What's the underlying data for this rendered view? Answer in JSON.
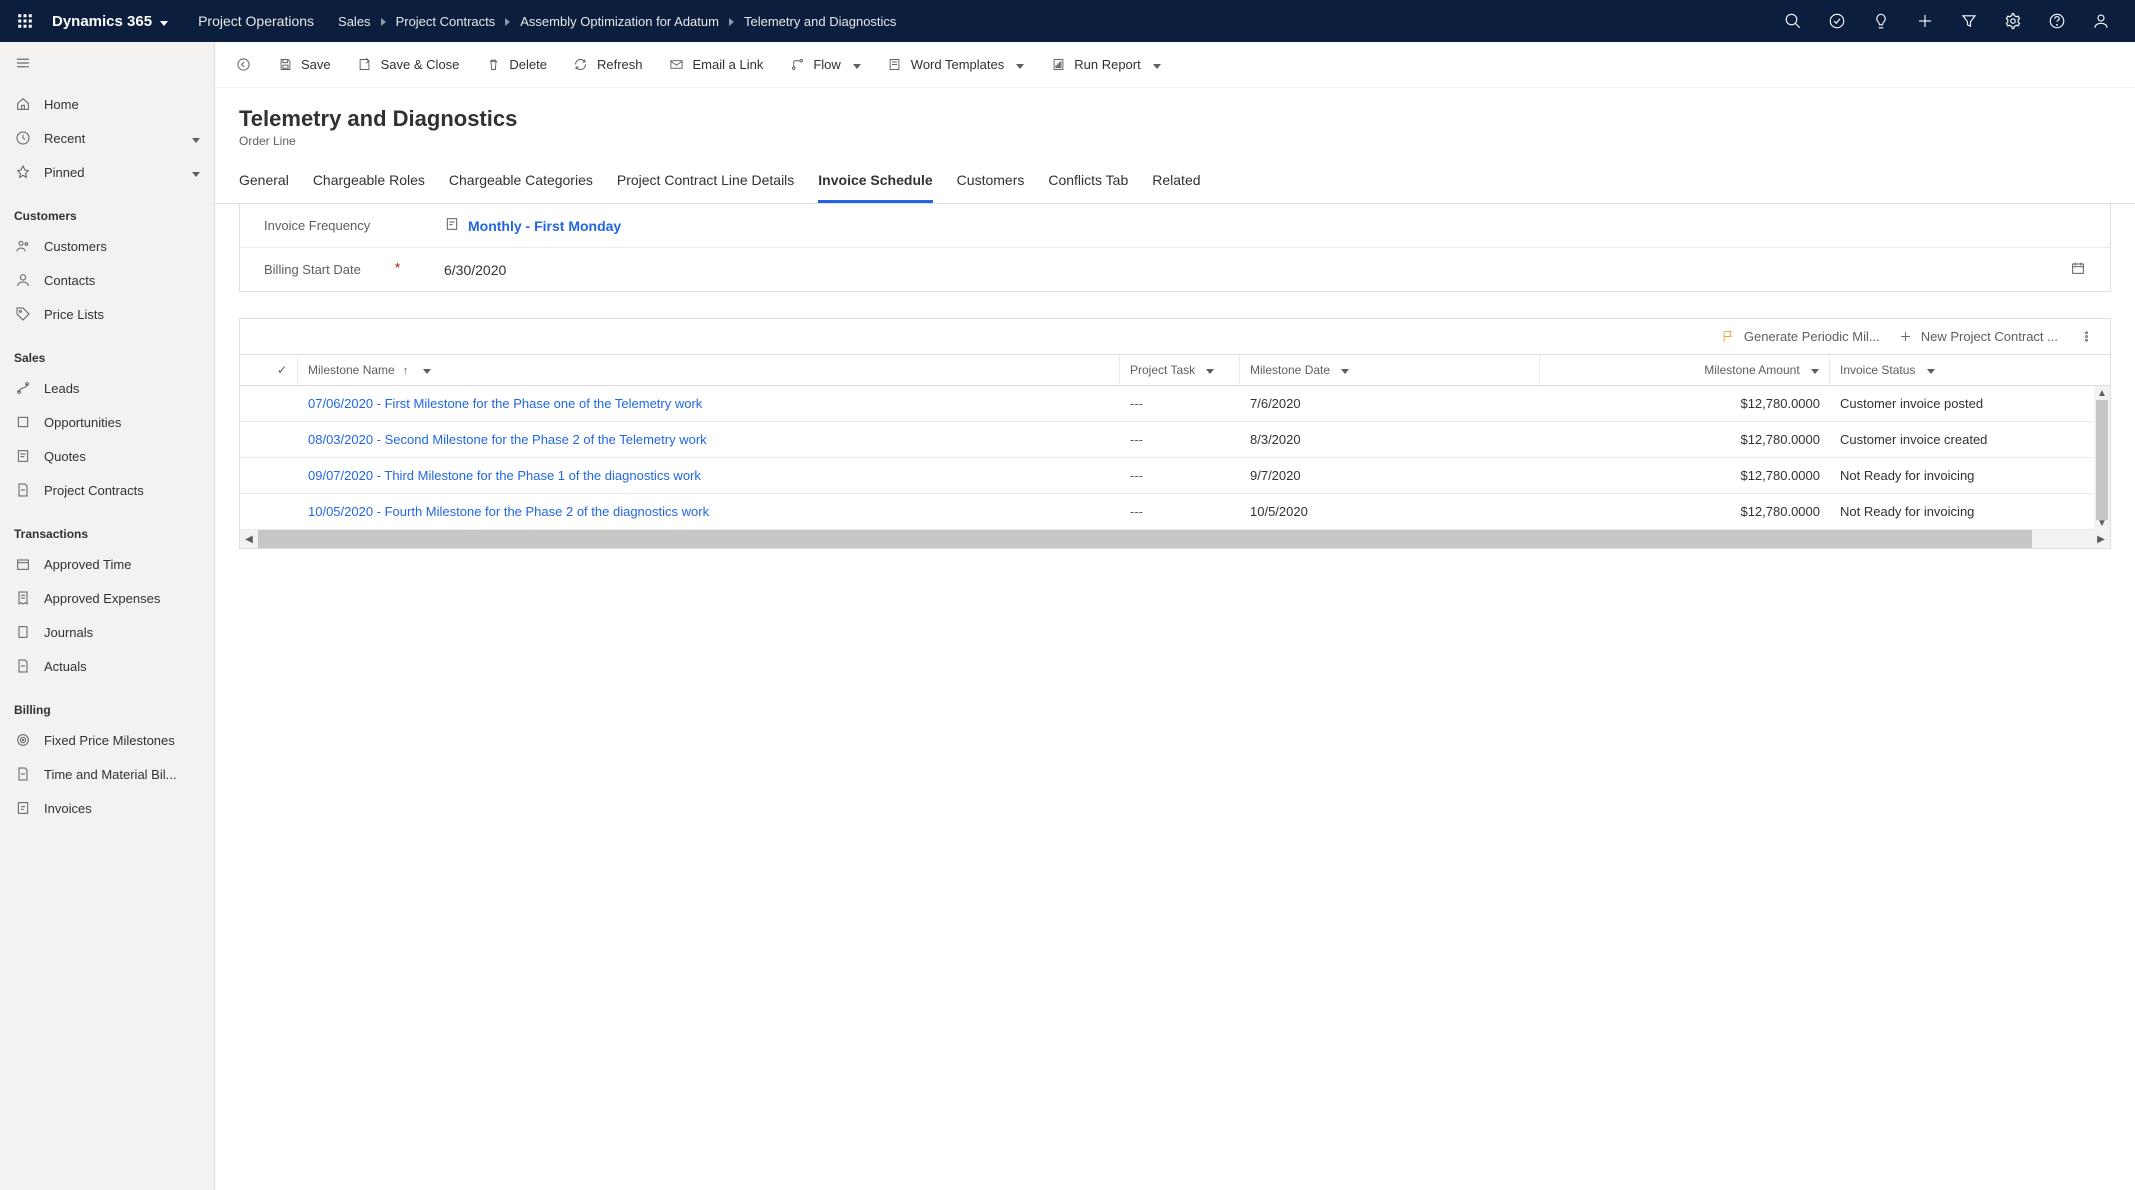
{
  "brand": "Dynamics 365",
  "module": "Project Operations",
  "breadcrumb": [
    "Sales",
    "Project Contracts",
    "Assembly Optimization for Adatum",
    "Telemetry and Diagnostics"
  ],
  "topIcons": [
    "search",
    "target",
    "bulb",
    "add",
    "filter",
    "gear",
    "help",
    "user"
  ],
  "commands": {
    "save": "Save",
    "saveClose": "Save & Close",
    "delete": "Delete",
    "refresh": "Refresh",
    "email": "Email a Link",
    "flow": "Flow",
    "word": "Word Templates",
    "report": "Run Report"
  },
  "page": {
    "title": "Telemetry and Diagnostics",
    "subtitle": "Order Line"
  },
  "tabs": [
    "General",
    "Chargeable Roles",
    "Chargeable Categories",
    "Project Contract Line Details",
    "Invoice Schedule",
    "Customers",
    "Conflicts Tab",
    "Related"
  ],
  "activeTab": 4,
  "form": {
    "invoiceFreqLabel": "Invoice Frequency",
    "invoiceFreqValue": "Monthly - First Monday",
    "billingStartLabel": "Billing Start Date",
    "billingStartValue": "6/30/2020"
  },
  "gridToolbar": {
    "generate": "Generate Periodic Mil...",
    "new": "New Project Contract ..."
  },
  "gridColumns": {
    "name": "Milestone Name",
    "task": "Project Task",
    "date": "Milestone Date",
    "amount": "Milestone Amount",
    "status": "Invoice Status"
  },
  "gridRows": [
    {
      "name": "07/06/2020 - First Milestone for the Phase one of the Telemetry work",
      "task": "---",
      "date": "7/6/2020",
      "amount": "$12,780.0000",
      "status": "Customer invoice posted"
    },
    {
      "name": "08/03/2020 - Second Milestone for the Phase 2 of the Telemetry work",
      "task": "---",
      "date": "8/3/2020",
      "amount": "$12,780.0000",
      "status": "Customer invoice created"
    },
    {
      "name": "09/07/2020 -  Third Milestone for the Phase 1 of the diagnostics work",
      "task": "---",
      "date": "9/7/2020",
      "amount": "$12,780.0000",
      "status": "Not Ready for invoicing"
    },
    {
      "name": "10/05/2020 -  Fourth Milestone for the Phase 2 of the diagnostics work",
      "task": "---",
      "date": "10/5/2020",
      "amount": "$12,780.0000",
      "status": "Not Ready for invoicing"
    }
  ],
  "sidebar": {
    "nav": [
      {
        "label": "Home",
        "icon": "home"
      },
      {
        "label": "Recent",
        "icon": "clock",
        "expandable": true
      },
      {
        "label": "Pinned",
        "icon": "pin",
        "expandable": true
      }
    ],
    "groups": [
      {
        "title": "Customers",
        "items": [
          {
            "label": "Customers",
            "icon": "people"
          },
          {
            "label": "Contacts",
            "icon": "person"
          },
          {
            "label": "Price Lists",
            "icon": "pricetag"
          }
        ]
      },
      {
        "title": "Sales",
        "items": [
          {
            "label": "Leads",
            "icon": "lead"
          },
          {
            "label": "Opportunities",
            "icon": "box"
          },
          {
            "label": "Quotes",
            "icon": "quote"
          },
          {
            "label": "Project Contracts",
            "icon": "doc"
          }
        ]
      },
      {
        "title": "Transactions",
        "items": [
          {
            "label": "Approved Time",
            "icon": "calendar"
          },
          {
            "label": "Approved Expenses",
            "icon": "receipt"
          },
          {
            "label": "Journals",
            "icon": "journal"
          },
          {
            "label": "Actuals",
            "icon": "doc"
          }
        ]
      },
      {
        "title": "Billing",
        "items": [
          {
            "label": "Fixed Price Milestones",
            "icon": "target"
          },
          {
            "label": "Time and Material Bil...",
            "icon": "doc"
          },
          {
            "label": "Invoices",
            "icon": "invoice"
          }
        ]
      }
    ]
  }
}
